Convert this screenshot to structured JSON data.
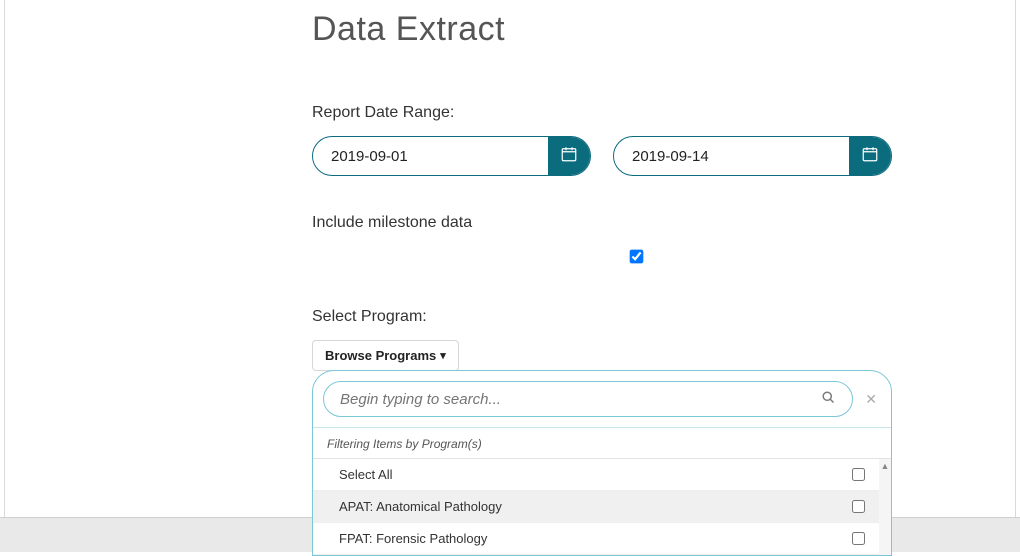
{
  "page_title": "Data Extract",
  "date_range": {
    "label": "Report Date Range:",
    "start": "2019-09-01",
    "end": "2019-09-14"
  },
  "milestone": {
    "label": "Include milestone data",
    "checked": true
  },
  "select_program": {
    "label": "Select Program:",
    "browse_label": "Browse Programs",
    "search_placeholder": "Begin typing to search...",
    "filter_header": "Filtering Items by Program(s)",
    "items": [
      {
        "label": "Select All",
        "checked": false
      },
      {
        "label": "APAT: Anatomical Pathology",
        "checked": false
      },
      {
        "label": "FPAT: Forensic Pathology",
        "checked": false
      }
    ]
  },
  "colors": {
    "accent": "#0a6c7d",
    "panel_border": "#7cc7d6"
  }
}
